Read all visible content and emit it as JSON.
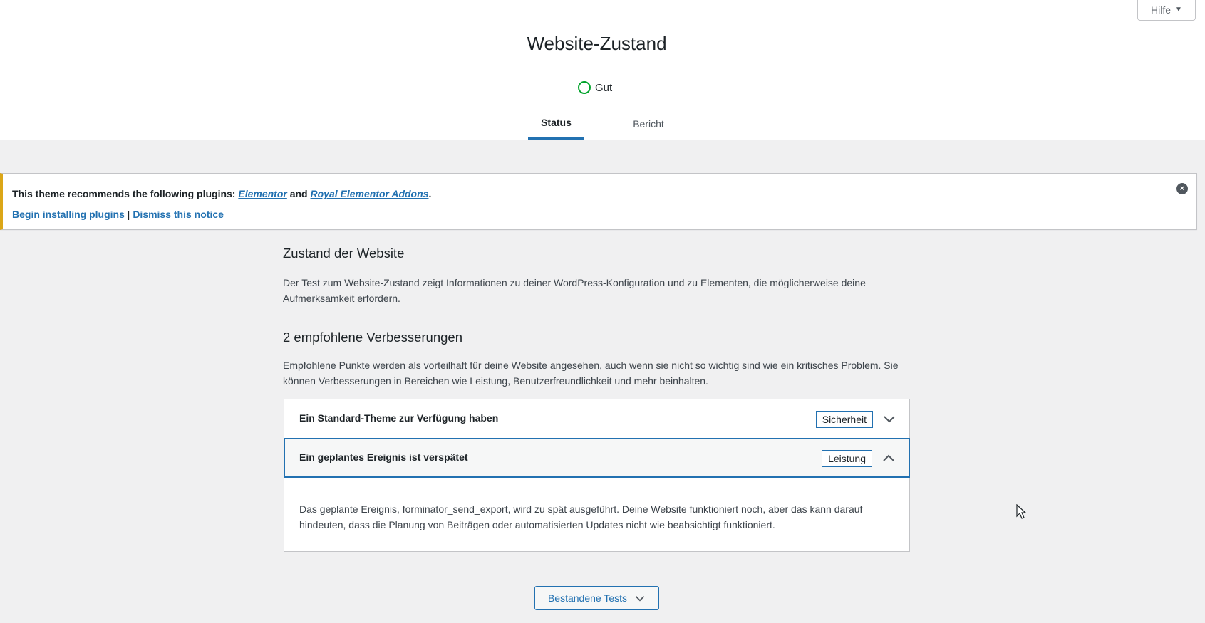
{
  "help": {
    "label": "Hilfe"
  },
  "header": {
    "title": "Website-Zustand",
    "score_label": "Gut",
    "tabs": [
      {
        "label": "Status",
        "active": true
      },
      {
        "label": "Bericht",
        "active": false
      }
    ]
  },
  "notice": {
    "text_before": "This theme recommends the following plugins: ",
    "plugin1": "Elementor",
    "and": " and ",
    "plugin2": "Royal Elementor Addons",
    "period": ".",
    "link_install": "Begin installing plugins",
    "separator": " | ",
    "link_dismiss": "Dismiss this notice"
  },
  "main": {
    "section_title": "Zustand der Website",
    "section_desc": "Der Test zum Website-Zustand zeigt Informationen zu deiner WordPress-Konfiguration und zu Elementen, die möglicherweise deine Aufmerksamkeit erfordern.",
    "recommended_title": "2 empfohlene Verbesserungen",
    "recommended_desc": "Empfohlene Punkte werden als vorteilhaft für deine Website angesehen, auch wenn sie nicht so wichtig sind wie ein kritisches Problem. Sie können Verbesserungen in Bereichen wie Leistung, Benutzerfreundlichkeit und mehr beinhalten.",
    "items": [
      {
        "title": "Ein Standard-Theme zur Verfügung haben",
        "badge": "Sicherheit",
        "expanded": false
      },
      {
        "title": "Ein geplantes Ereignis ist verspätet",
        "badge": "Leistung",
        "expanded": true,
        "body": "Das geplante Ereignis, forminator_send_export, wird zu spät ausgeführt. Deine Website funktioniert noch, aber das kann darauf hindeuten, dass die Planung von Beiträgen oder automatisierten Updates nicht wie beabsichtigt funktioniert."
      }
    ],
    "passed_button": "Bestandene Tests"
  },
  "colors": {
    "accent": "#2271b1",
    "good": "#00a32a",
    "warning": "#dba617"
  }
}
